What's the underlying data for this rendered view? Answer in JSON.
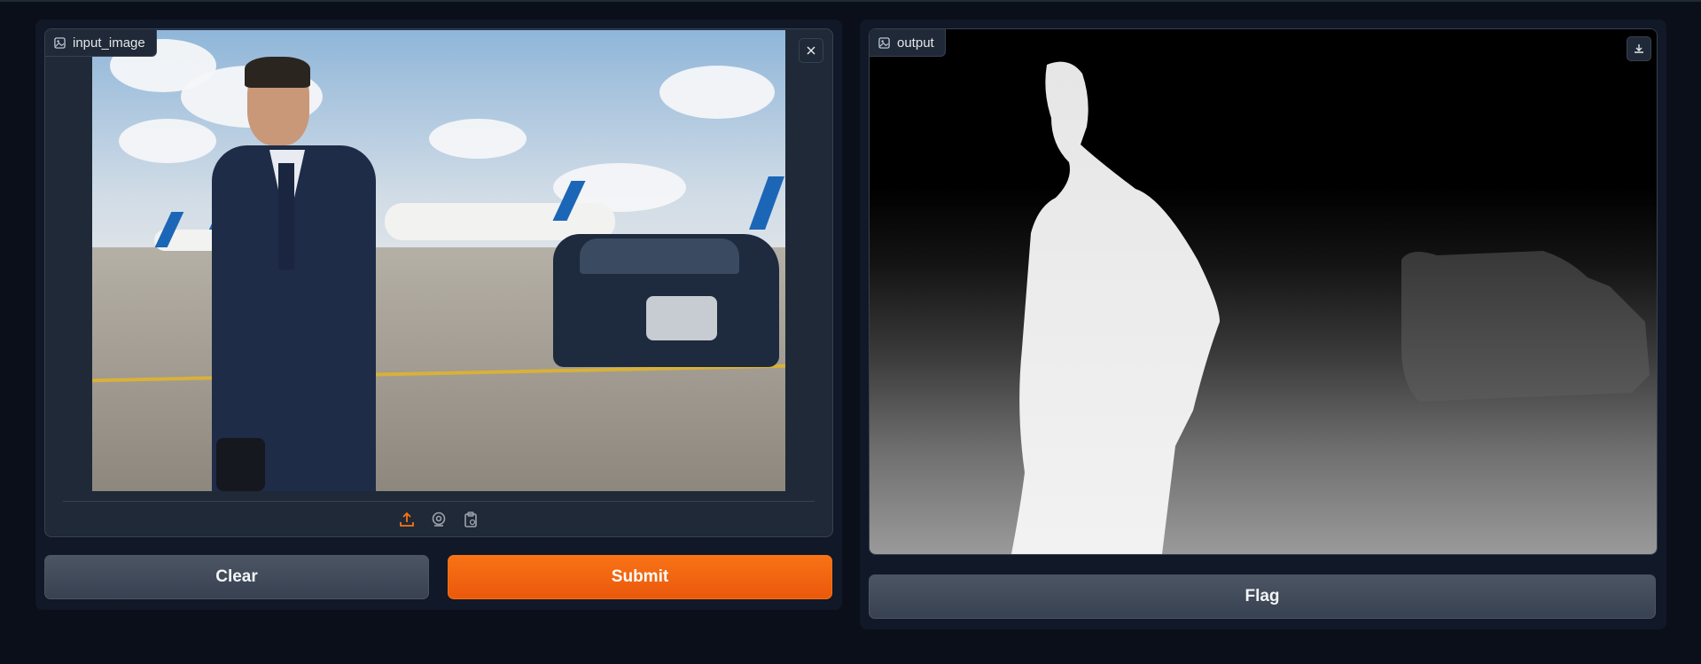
{
  "input": {
    "label": "input_image",
    "toolbar_icons": [
      "upload-icon",
      "webcam-icon",
      "clipboard-icon"
    ]
  },
  "output": {
    "label": "output"
  },
  "buttons": {
    "clear": "Clear",
    "submit": "Submit",
    "flag": "Flag"
  },
  "colors": {
    "background": "#0b0f19",
    "panel": "#111827",
    "accent": "#f97316",
    "secondary_button": "#4b5563"
  }
}
